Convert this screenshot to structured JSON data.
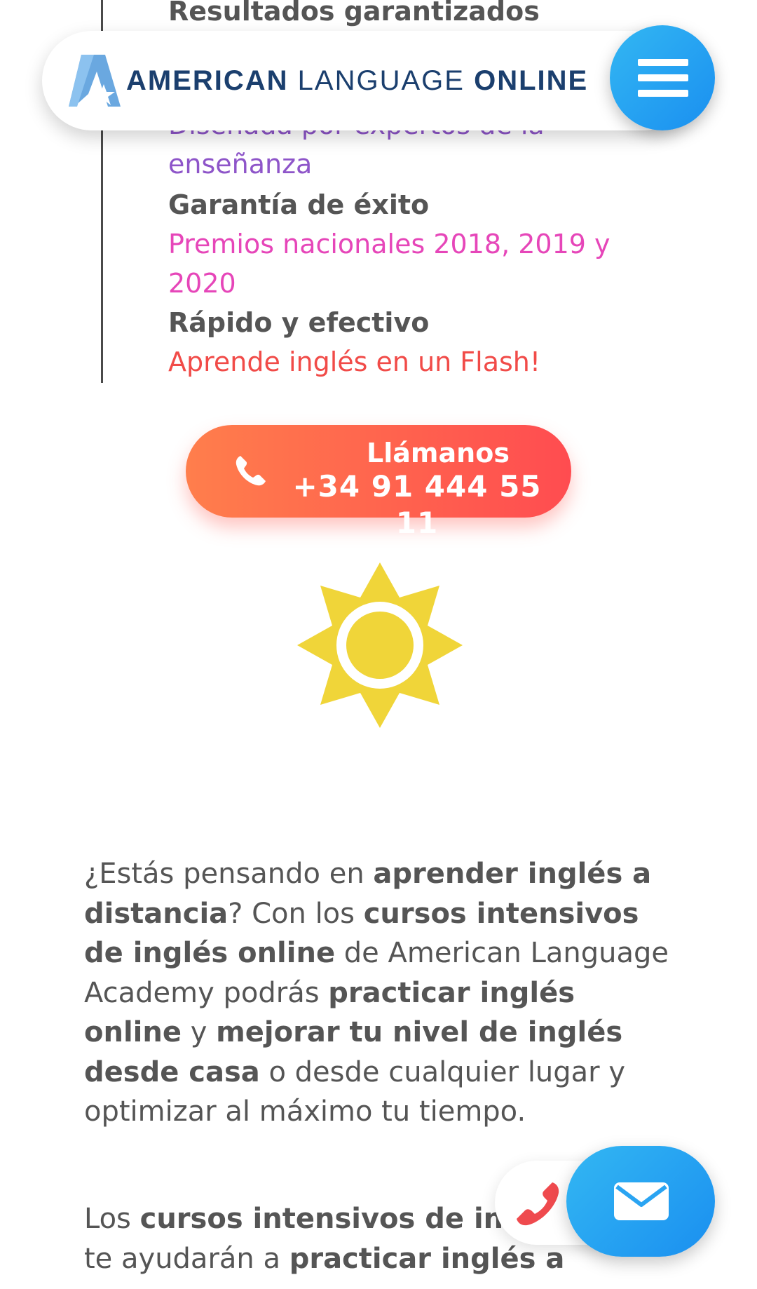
{
  "features": [
    {
      "title": "Resultados garantizados"
    },
    {
      "subtitle_lines": [
        "Diseñada por expertos de la",
        "enseñanza"
      ]
    },
    {
      "title": "Garantía de éxito",
      "subtitle_lines": [
        "Premios nacionales 2018, 2019 y",
        "2020"
      ]
    },
    {
      "title": "Rápido y efectivo",
      "subtitle_lines": [
        "Aprende inglés en un Flash!"
      ]
    }
  ],
  "header": {
    "brand_part1": "AMERICAN",
    "brand_part2": "LANGUAGE",
    "brand_part3": "ONLINE",
    "logo_icon": "star-a-logo-icon",
    "menu_icon": "hamburger-menu-icon"
  },
  "call": {
    "label": "Llámanos",
    "phone": "+34 91 444 55 11",
    "icon": "phone-icon"
  },
  "sun_icon": "sun-icon",
  "paragraph1": [
    {
      "text": "¿Estás pensando en ",
      "bold": false
    },
    {
      "text": "aprender inglés a distancia",
      "bold": true
    },
    {
      "text": "? Con los ",
      "bold": false
    },
    {
      "text": "cursos intensivos de inglés online",
      "bold": true
    },
    {
      "text": " de American Language Academy podrás ",
      "bold": false
    },
    {
      "text": "practicar inglés online",
      "bold": true
    },
    {
      "text": " y ",
      "bold": false
    },
    {
      "text": "mejorar tu nivel de inglés desde casa",
      "bold": true
    },
    {
      "text": " o desde cualquier lugar y optimizar al máximo tu tiempo.",
      "bold": false
    }
  ],
  "paragraph2": [
    {
      "text": "Los ",
      "bold": false
    },
    {
      "text": "cursos intensivos de in",
      "bold": true
    },
    {
      "text": " te ayudarán a ",
      "bold": false
    },
    {
      "text": "practicar inglés a",
      "bold": true
    }
  ],
  "floating": {
    "phone_icon": "phone-icon",
    "mail_icon": "envelope-icon"
  },
  "colors": {
    "accent_blue": "#1a8ff0",
    "call_gradient_start": "#ff7e4c",
    "call_gradient_end": "#ff4c50",
    "sun_yellow": "#f0d539",
    "purple": "#8e55c9",
    "pink": "#e646b9",
    "red": "#f14b48",
    "brand_navy": "#1b3f6e"
  }
}
